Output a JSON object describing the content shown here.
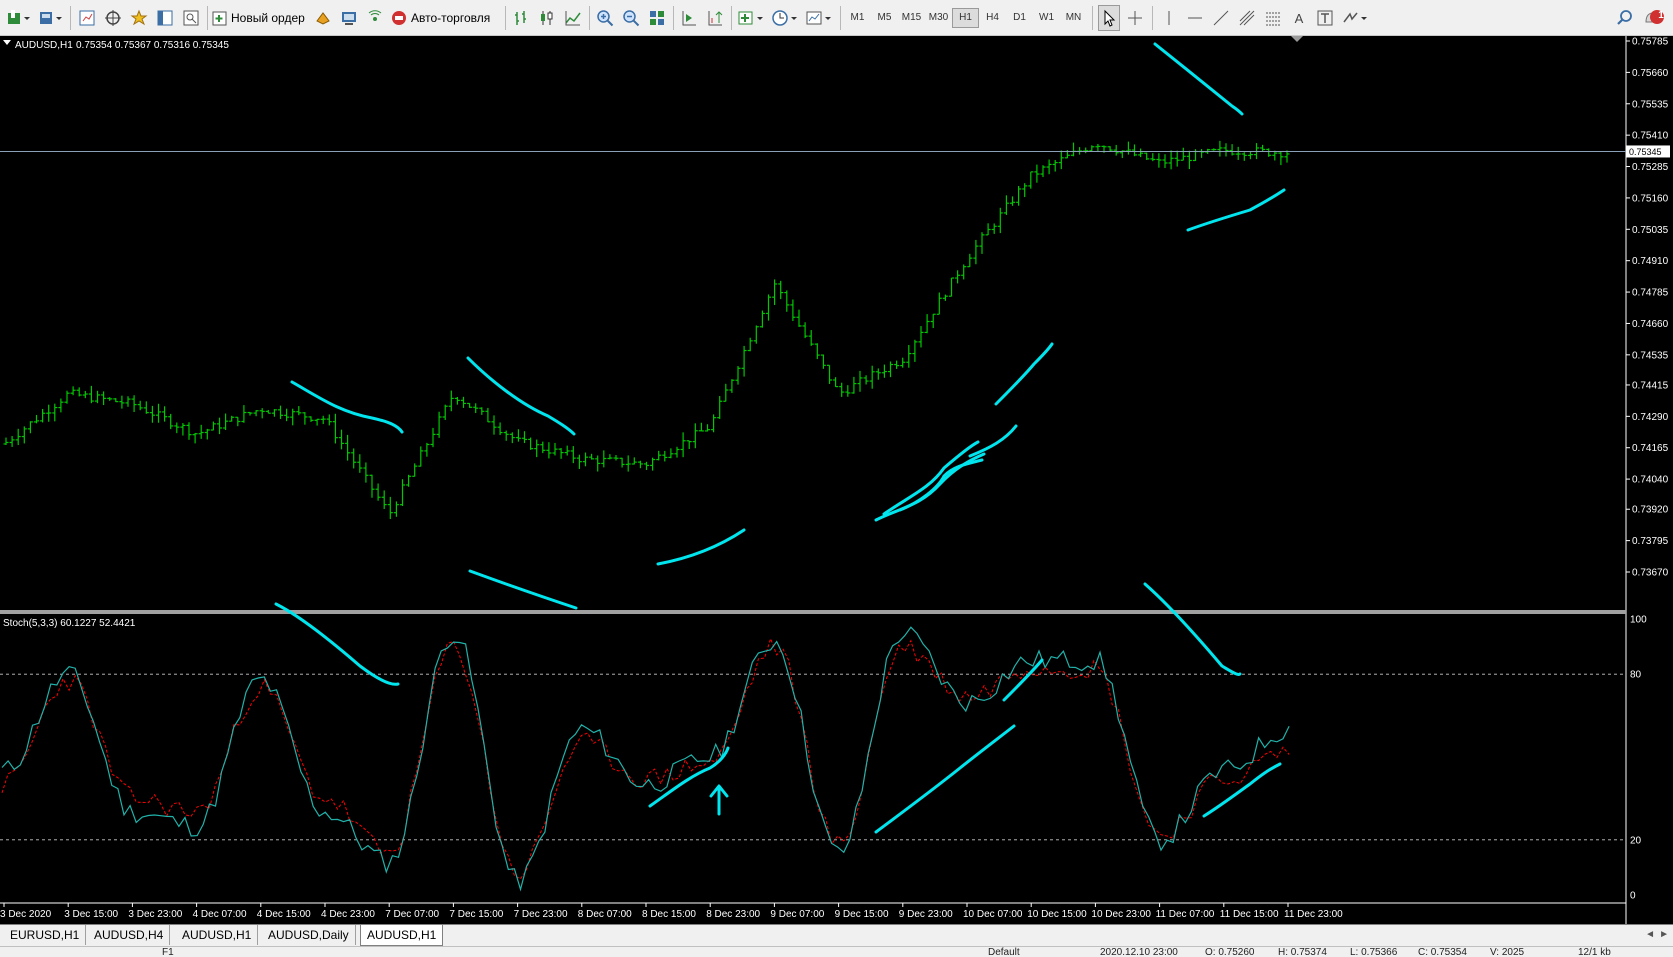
{
  "toolbar": {
    "new_order_label": "Новый ордер",
    "autotrading_label": "Авто-торговля",
    "timeframes": [
      "M1",
      "M5",
      "M15",
      "M30",
      "H1",
      "H4",
      "D1",
      "W1",
      "MN"
    ],
    "active_timeframe": "H1",
    "icons": [
      "new-chart-icon",
      "profiles-icon",
      "market-watch-icon",
      "navigator-icon",
      "favorites-icon",
      "data-window-icon",
      "terminal-icon",
      "tester-icon",
      "new-order-icon",
      "metaeditor-icon",
      "signals-icon",
      "autotrading-icon",
      "bar-chart-icon",
      "candles-icon",
      "line-chart-icon",
      "zoom-in-icon",
      "zoom-out-icon",
      "tile-windows-icon",
      "chart-shift-icon",
      "autoscroll-icon",
      "indicators-icon",
      "periods-icon",
      "templates-icon",
      "cursor-icon",
      "crosshair-icon",
      "vertical-line-icon",
      "horizontal-line-icon",
      "trendline-icon",
      "equidistant-channel-icon",
      "fibonacci-icon",
      "text-icon",
      "text-label-icon",
      "arrows-icon",
      "search-icon",
      "notification-icon"
    ],
    "notification_count": "1"
  },
  "chart": {
    "symbol_label": "AUDUSD,H1",
    "ohlc_text": "0.75354 0.75367 0.75316 0.75345",
    "current_price": "0.75345",
    "price_ticks": [
      "0.75785",
      "0.75660",
      "0.75535",
      "0.75410",
      "0.75285",
      "0.75160",
      "0.75035",
      "0.74910",
      "0.74785",
      "0.74660",
      "0.74535",
      "0.74415",
      "0.74290",
      "0.74165",
      "0.74040",
      "0.73920",
      "0.73795",
      "0.73670"
    ],
    "time_labels": [
      "3 Dec 2020",
      "3 Dec 15:00",
      "3 Dec 23:00",
      "4 Dec 07:00",
      "4 Dec 15:00",
      "4 Dec 23:00",
      "7 Dec 07:00",
      "7 Dec 15:00",
      "7 Dec 23:00",
      "8 Dec 07:00",
      "8 Dec 15:00",
      "8 Dec 23:00",
      "9 Dec 07:00",
      "9 Dec 15:00",
      "9 Dec 23:00",
      "10 Dec 07:00",
      "10 Dec 15:00",
      "10 Dec 23:00",
      "11 Dec 07:00",
      "11 Dec 15:00",
      "11 Dec 23:00"
    ],
    "bar_color": "#00c800",
    "drawing_color": "#00e5ee",
    "grid_color": "#c8c8c8"
  },
  "indicator": {
    "label": "Stoch(5,3,3) 60.1227 52.4421",
    "levels": [
      "100",
      "80",
      "20",
      "0"
    ],
    "main_color": "#20b2aa",
    "signal_color": "#ff0000"
  },
  "chart_data": {
    "type": "bar",
    "symbol": "AUDUSD",
    "timeframe": "H1",
    "ylim": [
      0.7367,
      0.758
    ],
    "x": [
      "3 Dec 2020",
      "3 Dec 15:00",
      "3 Dec 23:00",
      "4 Dec 07:00",
      "4 Dec 15:00",
      "4 Dec 23:00",
      "7 Dec 07:00",
      "7 Dec 15:00",
      "7 Dec 23:00",
      "8 Dec 07:00",
      "8 Dec 15:00",
      "8 Dec 23:00",
      "9 Dec 07:00",
      "9 Dec 15:00",
      "9 Dec 23:00",
      "10 Dec 07:00",
      "10 Dec 15:00",
      "10 Dec 23:00",
      "11 Dec 07:00",
      "11 Dec 15:00",
      "11 Dec 23:00"
    ],
    "close": [
      0.7418,
      0.7438,
      0.7434,
      0.7422,
      0.7432,
      0.7428,
      0.739,
      0.7438,
      0.7419,
      0.7412,
      0.741,
      0.7425,
      0.7482,
      0.7438,
      0.7452,
      0.7492,
      0.7525,
      0.7538,
      0.753,
      0.7535,
      0.7534
    ],
    "stochastic": {
      "main": [
        45,
        80,
        30,
        25,
        78,
        30,
        12,
        95,
        5,
        60,
        40,
        50,
        92,
        15,
        95,
        70,
        85,
        85,
        20,
        45,
        60
      ],
      "signal": [
        40,
        78,
        35,
        30,
        75,
        35,
        15,
        90,
        8,
        55,
        42,
        48,
        90,
        18,
        90,
        72,
        83,
        82,
        22,
        42,
        52
      ],
      "levels": [
        20,
        80
      ],
      "ylim": [
        0,
        100
      ]
    }
  },
  "tabs": [
    "EURUSD,H1",
    "AUDUSD,H4",
    "AUDUSD,H1",
    "AUDUSD,Daily",
    "AUDUSD,H1"
  ],
  "active_tab": "AUDUSD,H1",
  "status": {
    "help": "F1",
    "profile": "Default",
    "datetime": "2020.12.10 23:00",
    "open": "O: 0.75260",
    "high": "H: 0.75374",
    "low": "L: 0.75366",
    "close": "C: 0.75354",
    "volume": "V: 2025",
    "traffic": "12/1 kb"
  }
}
